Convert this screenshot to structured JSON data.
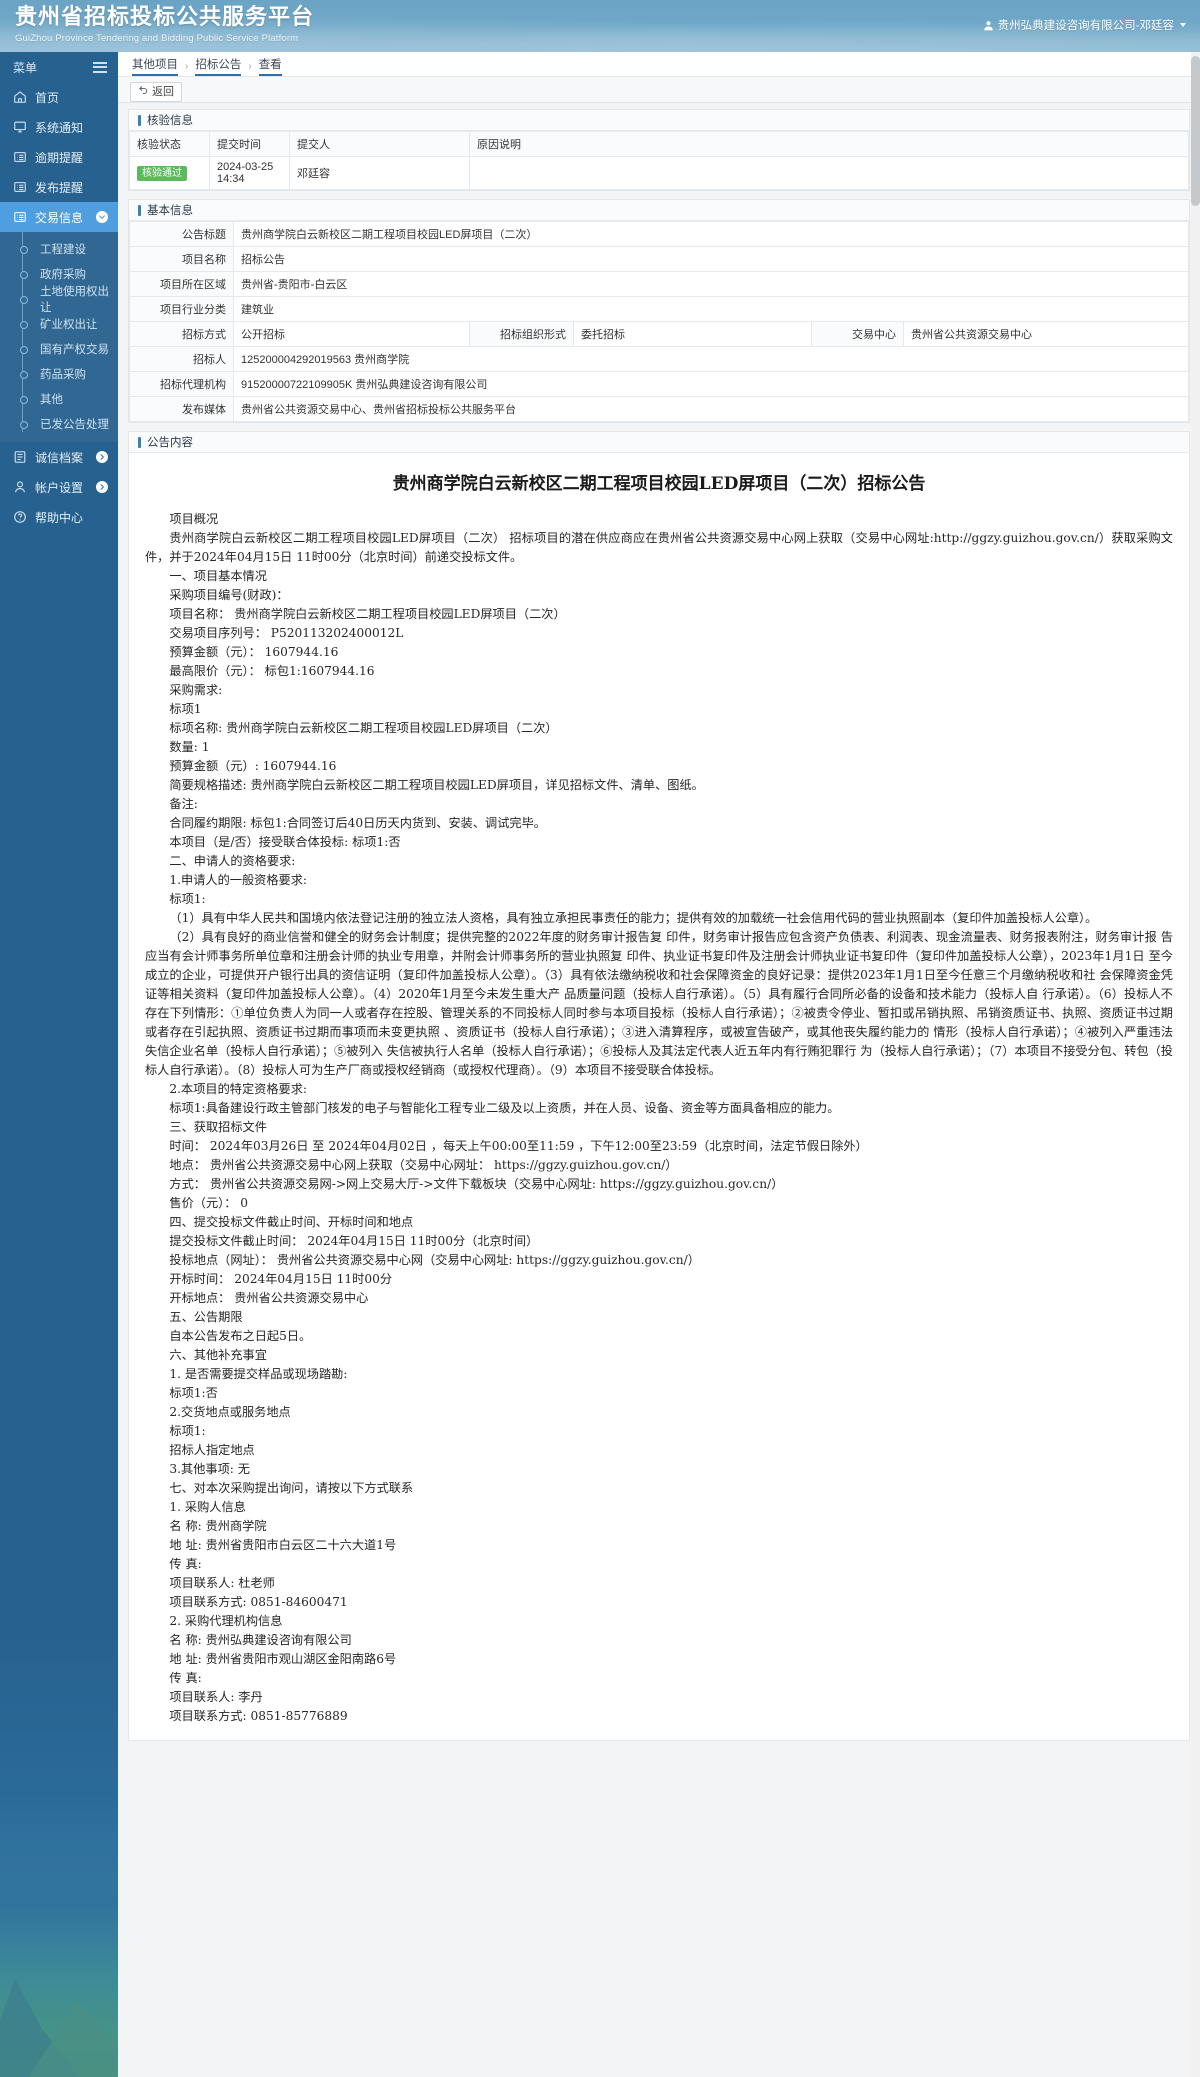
{
  "header": {
    "brand_cn": "贵州省招标投标公共服务平台",
    "brand_en": "GuiZhou Province Tendering and Bidding Public Service Platform",
    "user": "贵州弘典建设咨询有限公司-邓廷容"
  },
  "sidebar": {
    "menu_label": "菜单",
    "items": [
      {
        "label": "首页",
        "icon": "home-icon",
        "active": false,
        "expandable": false
      },
      {
        "label": "系统通知",
        "icon": "monitor-icon",
        "active": false,
        "expandable": false
      },
      {
        "label": "逾期提醒",
        "icon": "list-icon",
        "active": false,
        "expandable": false
      },
      {
        "label": "发布提醒",
        "icon": "list-icon",
        "active": false,
        "expandable": false
      },
      {
        "label": "交易信息",
        "icon": "list-icon",
        "active": true,
        "expandable": true
      }
    ],
    "sub_items": [
      "工程建设",
      "政府采购",
      "土地使用权出让",
      "矿业权出让",
      "国有产权交易",
      "药品采购",
      "其他",
      "已发公告处理"
    ],
    "items_bottom": [
      {
        "label": "诚信档案",
        "icon": "archive-icon",
        "expandable": true
      },
      {
        "label": "帐户设置",
        "icon": "user-icon",
        "expandable": true
      },
      {
        "label": "帮助中心",
        "icon": "question-icon",
        "expandable": false
      }
    ]
  },
  "breadcrumb": {
    "items": [
      "其他项目",
      "招标公告",
      "查看"
    ],
    "separator": "›"
  },
  "toolbar": {
    "back_label": "返回",
    "back_icon": "undo-icon"
  },
  "verify_panel": {
    "title": "核验信息",
    "headers": [
      "核验状态",
      "提交时间",
      "提交人",
      "原因说明"
    ],
    "rows": [
      {
        "status": "核验通过",
        "time": "2024-03-25 14:34",
        "person": "邓廷容",
        "reason": ""
      }
    ]
  },
  "basic_panel": {
    "title": "基本信息",
    "rows": [
      {
        "label": "公告标题",
        "value": "贵州商学院白云新校区二期工程项目校园LED屏项目（二次）"
      },
      {
        "label": "项目名称",
        "value": "招标公告"
      },
      {
        "label": "项目所在区域",
        "value": "贵州省-贵阳市-白云区"
      },
      {
        "label": "项目行业分类",
        "value": "建筑业"
      }
    ],
    "triple_row": [
      {
        "label": "招标方式",
        "value": "公开招标"
      },
      {
        "label": "招标组织形式",
        "value": "委托招标"
      },
      {
        "label": "交易中心",
        "value": "贵州省公共资源交易中心"
      }
    ],
    "rows_tail": [
      {
        "label": "招标人",
        "value": "125200004292019563 贵州商学院"
      },
      {
        "label": "招标代理机构",
        "value": "91520000722109905K 贵州弘典建设咨询有限公司"
      },
      {
        "label": "发布媒体",
        "value": "贵州省公共资源交易中心、贵州省招标投标公共服务平台"
      }
    ]
  },
  "content_panel": {
    "title": "公告内容",
    "doc_title": "贵州商学院白云新校区二期工程项目校园LED屏项目（二次）招标公告",
    "paragraphs": [
      {
        "indent": true,
        "text": "项目概况"
      },
      {
        "indent": true,
        "text": "贵州商学院白云新校区二期工程项目校园LED屏项目（二次）  招标项目的潜在供应商应在贵州省公共资源交易中心网上获取（交易中心网址:http://ggzy.guizhou.gov.cn/）获取采购文件，并于2024年04月15日 11时00分（北京时间）前递交投标文件。"
      },
      {
        "indent": true,
        "text": "一、项目基本情况"
      },
      {
        "indent": true,
        "text": "采购项目编号(财政)："
      },
      {
        "indent": true,
        "text": "项目名称：  贵州商学院白云新校区二期工程项目校园LED屏项目（二次）"
      },
      {
        "indent": true,
        "text": "交易项目序列号：    P520113202400012L"
      },
      {
        "indent": true,
        "text": "预算金额（元）：  1607944.16"
      },
      {
        "indent": true,
        "text": "最高限价（元）：    标包1:1607944.16"
      },
      {
        "indent": true,
        "text": "采购需求:"
      },
      {
        "indent": true,
        "text": "标项1"
      },
      {
        "indent": true,
        "text": "标项名称: 贵州商学院白云新校区二期工程项目校园LED屏项目（二次）"
      },
      {
        "indent": true,
        "text": "数量: 1"
      },
      {
        "indent": true,
        "text": "预算金额（元）: 1607944.16"
      },
      {
        "indent": true,
        "text": "简要规格描述:  贵州商学院白云新校区二期工程项目校园LED屏项目，详见招标文件、清单、图纸。"
      },
      {
        "indent": true,
        "text": "备注:"
      },
      {
        "indent": true,
        "text": "合同履约期限:    标包1:合同签订后40日历天内货到、安装、调试完毕。"
      },
      {
        "indent": true,
        "text": "本项目（是/否）接受联合体投标: 标项1:否"
      },
      {
        "indent": true,
        "text": "二、申请人的资格要求:"
      },
      {
        "indent": true,
        "text": "1.申请人的一般资格要求:"
      },
      {
        "indent": true,
        "text": "标项1:"
      },
      {
        "indent": true,
        "text": "（1）具有中华人民共和国境内依法登记注册的独立法人资格，具有独立承担民事责任的能力；提供有效的加载统一社会信用代码的营业执照副本（复印件加盖投标人公章）。"
      },
      {
        "indent": true,
        "text": "（2）具有良好的商业信誉和健全的财务会计制度；提供完整的2022年度的财务审计报告复  印件，财务审计报告应包含资产负债表、利润表、现金流量表、财务报表附注，财务审计报 告应当有会计师事务所单位章和注册会计师的执业专用章，并附会计师事务所的营业执照复 印件、执业证书复印件及注册会计师执业证书复印件（复印件加盖投标人公章），2023年1月1日 至今成立的企业，可提供开户银行出具的资信证明（复印件加盖投标人公章）。（3）具有依法缴纳税收和社会保障资金的良好记录：提供2023年1月1日至今任意三个月缴纳税收和社 会保障资金凭证等相关资料（复印件加盖投标人公章）。（4）2020年1月至今未发生重大产 品质量问题（投标人自行承诺）。（5）具有履行合同所必备的设备和技术能力（投标人自    行承诺）。（6）投标人不存在下列情形：①单位负责人为同一人或者存在控股、管理关系的不同投标人同时参与本项目投标（投标人自行承诺）；②被责令停业、暂扣或吊销执照、吊销资质证书、执照、资质证书过期或者存在引起执照、资质证书过期而事项而未变更执照 、资质证书（投标人自行承诺）；③进入清算程序，或被宣告破产，或其他丧失履约能力的 情形（投标人自行承诺）；④被列入严重违法失信企业名单（投标人自行承诺）；⑤被列入 失信被执行人名单（投标人自行承诺）；⑥投标人及其法定代表人近五年内有行贿犯罪行  为（投标人自行承诺）；（7）本项目不接受分包、转包（投标人自行承诺）。（8）投标人可为生产厂商或授权经销商（或授权代理商）。（9）本项目不接受联合体投标。"
      },
      {
        "indent": true,
        "text": "2.本项目的特定资格要求:"
      },
      {
        "indent": true,
        "text": "标项1:具备建设行政主管部门核发的电子与智能化工程专业二级及以上资质，并在人员、设备、资金等方面具备相应的能力。"
      },
      {
        "indent": true,
        "text": "三、获取招标文件"
      },
      {
        "indent": true,
        "text": "时间：  2024年03月26日 至 2024年04月02日 ，每天上午00:00至11:59 ，下午12:00至23:59（北京时间，法定节假日除外）"
      },
      {
        "indent": true,
        "text": "地点：  贵州省公共资源交易中心网上获取（交易中心网址： https://ggzy.guizhou.gov.cn/）"
      },
      {
        "indent": true,
        "text": "方式：  贵州省公共资源交易网->网上交易大厅->文件下载板块（交易中心网址: https://ggzy.guizhou.gov.cn/）"
      },
      {
        "indent": true,
        "text": "售价（元）：  0"
      },
      {
        "indent": true,
        "text": "四、提交投标文件截止时间、开标时间和地点"
      },
      {
        "indent": true,
        "text": "提交投标文件截止时间：  2024年04月15日 11时00分（北京时间）"
      },
      {
        "indent": true,
        "text": "投标地点（网址）：  贵州省公共资源交易中心网（交易中心网址: https://ggzy.guizhou.gov.cn/）"
      },
      {
        "indent": true,
        "text": "开标时间：  2024年04月15日 11时00分"
      },
      {
        "indent": true,
        "text": "开标地点：  贵州省公共资源交易中心"
      },
      {
        "indent": true,
        "text": "五、公告期限"
      },
      {
        "indent": true,
        "text": "自本公告发布之日起5日。"
      },
      {
        "indent": true,
        "text": "六、其他补充事宜"
      },
      {
        "indent": true,
        "text": "1. 是否需要提交样品或现场踏勘:"
      },
      {
        "indent": true,
        "text": "标项1:否"
      },
      {
        "indent": true,
        "text": "2.交货地点或服务地点"
      },
      {
        "indent": true,
        "text": "标项1:"
      },
      {
        "indent": true,
        "text": "招标人指定地点"
      },
      {
        "indent": true,
        "text": "3.其他事项:  无"
      },
      {
        "indent": true,
        "text": "七、对本次采购提出询问，请按以下方式联系"
      },
      {
        "indent": true,
        "text": "1. 采购人信息"
      },
      {
        "indent": true,
        "text": "名  称:  贵州商学院"
      },
      {
        "indent": true,
        "text": "地  址:  贵州省贵阳市白云区二十六大道1号"
      },
      {
        "indent": true,
        "text": "传  真:"
      },
      {
        "indent": true,
        "text": "项目联系人:  杜老师"
      },
      {
        "indent": true,
        "text": "项目联系方式:  0851-84600471"
      },
      {
        "indent": true,
        "text": "2. 采购代理机构信息"
      },
      {
        "indent": true,
        "text": "名  称:  贵州弘典建设咨询有限公司"
      },
      {
        "indent": true,
        "text": "地  址:  贵州省贵阳市观山湖区金阳南路6号"
      },
      {
        "indent": true,
        "text": "传  真:"
      },
      {
        "indent": true,
        "text": "项目联系人:  李丹"
      },
      {
        "indent": true,
        "text": "项目联系方式:  0851-85776889"
      }
    ]
  },
  "colors": {
    "header_blue": "#6ba3c4",
    "sidebar_blue": "#27618f",
    "active_item": "#4f9fe0",
    "accent": "#3c7fb8",
    "badge_green": "#5bbb5b"
  }
}
